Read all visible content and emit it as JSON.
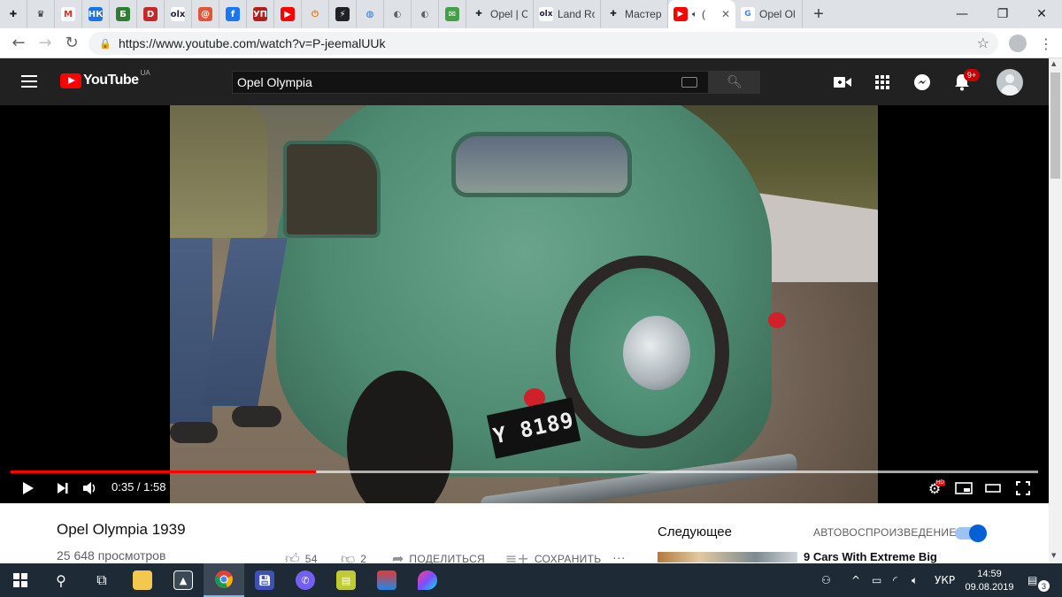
{
  "browser": {
    "pinned_tabs": [
      {
        "icon": "puzzle-icon",
        "glyph": "✚",
        "bg": "#dee1e6",
        "fg": "#202124"
      },
      {
        "icon": "crown-icon",
        "glyph": "♛",
        "bg": "#dee1e6",
        "fg": "#202124"
      },
      {
        "icon": "gmail-icon",
        "glyph": "M",
        "bg": "#ffffff",
        "fg": "#d93025"
      },
      {
        "icon": "nk-icon",
        "glyph": "НК",
        "bg": "#1a73e8",
        "fg": "#ffffff"
      },
      {
        "icon": "news-icon",
        "glyph": "Б",
        "bg": "#2e7d32",
        "fg": "#ffffff"
      },
      {
        "icon": "d-icon",
        "glyph": "D",
        "bg": "#c62828",
        "fg": "#ffffff"
      },
      {
        "icon": "olx-icon",
        "glyph": "olx",
        "bg": "#ffffff",
        "fg": "#23263a"
      },
      {
        "icon": "ukrnet-icon",
        "glyph": "@",
        "bg": "#e35335",
        "fg": "#ffffff"
      },
      {
        "icon": "facebook-icon",
        "glyph": "f",
        "bg": "#1877f2",
        "fg": "#ffffff"
      },
      {
        "icon": "up-icon",
        "glyph": "УП",
        "bg": "#b71c1c",
        "fg": "#ffffff"
      },
      {
        "icon": "youtube-icon",
        "glyph": "▶",
        "bg": "#ff0000",
        "fg": "#ffffff"
      },
      {
        "icon": "power-icon",
        "glyph": "⏻",
        "bg": "#dee1e6",
        "fg": "#e8710a"
      },
      {
        "icon": "bolt-icon",
        "glyph": "⚡",
        "bg": "#202124",
        "fg": "#ffffff"
      },
      {
        "icon": "globe-blue-icon",
        "glyph": "◍",
        "bg": "#dee1e6",
        "fg": "#1a73e8"
      },
      {
        "icon": "globe-icon",
        "glyph": "◐",
        "bg": "#dee1e6",
        "fg": "#5f6368"
      },
      {
        "icon": "globe-icon-2",
        "glyph": "◐",
        "bg": "#dee1e6",
        "fg": "#5f6368"
      },
      {
        "icon": "mail-icon",
        "glyph": "✉",
        "bg": "#43a047",
        "fg": "#ffffff"
      }
    ],
    "titled_tabs": [
      {
        "icon": "puzzle-icon",
        "glyph": "✚",
        "bg": "#dee1e6",
        "fg": "#202124",
        "title": "Opel | C",
        "active": false
      },
      {
        "icon": "olx-icon",
        "glyph": "olx",
        "bg": "#ffffff",
        "fg": "#23263a",
        "title": "Land Ro",
        "active": false
      },
      {
        "icon": "puzzle-icon",
        "glyph": "✚",
        "bg": "#dee1e6",
        "fg": "#202124",
        "title": "Мастер",
        "active": false
      },
      {
        "icon": "youtube-icon",
        "glyph": "▶",
        "bg": "#ff0000",
        "fg": "#ffffff",
        "title": "(",
        "active": true
      },
      {
        "icon": "google-icon",
        "glyph": "G",
        "bg": "#ffffff",
        "fg": "#4285f4",
        "title": "Opel Ol",
        "active": false
      }
    ],
    "new_tab_glyph": "+",
    "url": "https://www.youtube.com/watch?v=P-jeemalUUk"
  },
  "youtube": {
    "logo_text": "YouTube",
    "country_code": "UA",
    "search_value": "Opel Olympia",
    "notification_count": "9+"
  },
  "video": {
    "current_time": "0:35",
    "duration": "1:58",
    "progress_fraction": 0.297,
    "buffer_fraction": 1.0,
    "plate_text": "Y 8189",
    "hd_label": "HD"
  },
  "watch": {
    "title": "Opel Olympia 1939",
    "views": "25 648 просмотров",
    "likes": "54",
    "dislikes": "2",
    "share_label": "ПОДЕЛИТЬСЯ",
    "save_label": "СОХРАНИТЬ",
    "more_label": "···"
  },
  "sidebar": {
    "next_label": "Следующее",
    "autoplay_label": "АВТОВОСПРОИЗВЕДЕНИЕ",
    "autoplay_on": true,
    "next_video_title": "9 Cars With Extreme Big"
  },
  "taskbar": {
    "language": "УКР",
    "time": "14:59",
    "date": "09.08.2019",
    "notification_count": "3"
  }
}
